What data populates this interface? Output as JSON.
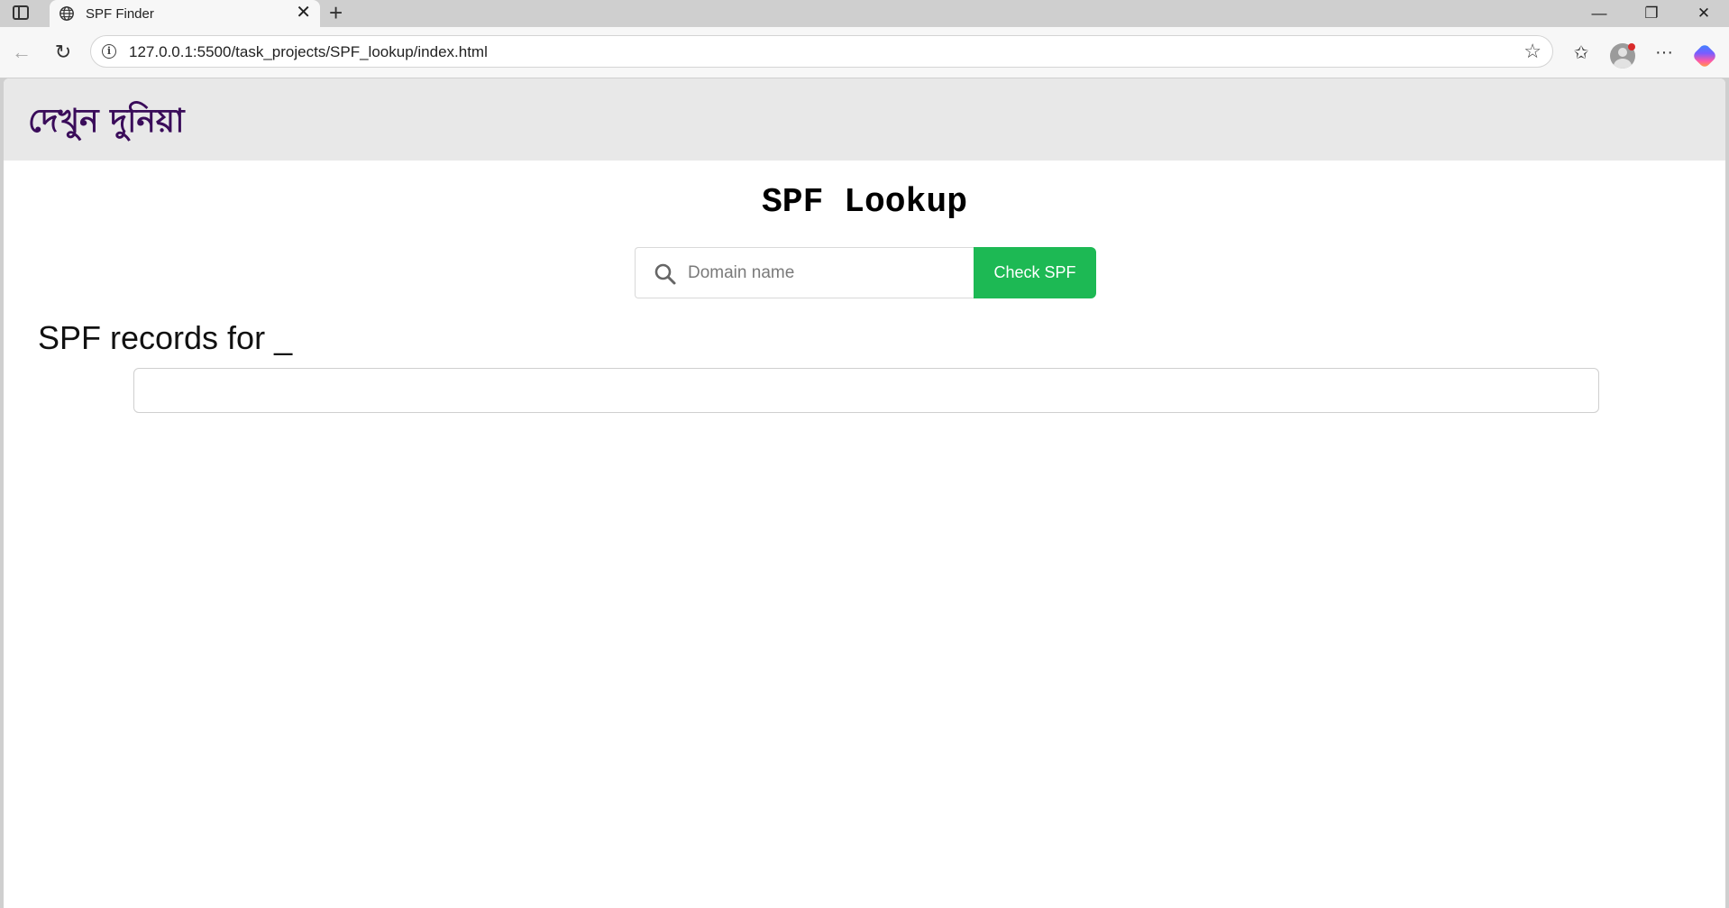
{
  "browser": {
    "tab_title": "SPF Finder",
    "tab_close": "✕",
    "new_tab": "+",
    "url": "127.0.0.1:5500/task_projects/SPF_lookup/index.html",
    "info_icon": "i",
    "window_controls": {
      "minimize": "—",
      "restore": "❐",
      "close": "✕"
    },
    "back": "←",
    "reload": "↻",
    "favorite": "☆",
    "favorites": "✩",
    "more": "···"
  },
  "site": {
    "logo": "দেখুন দুনিয়া"
  },
  "main": {
    "title": "SPF Lookup",
    "search_placeholder": "Domain name",
    "search_value": "",
    "check_button": "Check SPF",
    "records_heading": "SPF records for _",
    "records_content": ""
  },
  "colors": {
    "logo": "#3a0c5a",
    "button_bg": "#1db954",
    "header_bg": "#e8e8e8"
  }
}
